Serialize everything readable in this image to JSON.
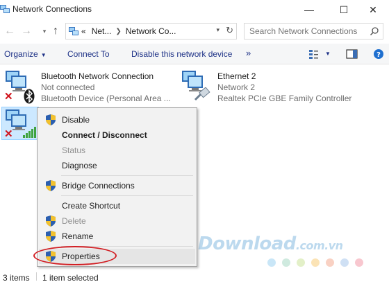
{
  "window": {
    "title": "Network Connections",
    "minimize": "—",
    "maximize": "☐",
    "close": "✕"
  },
  "nav": {
    "back": "←",
    "forward": "→",
    "up": "↑"
  },
  "address": {
    "overflow": "«",
    "crumb1": "Net...",
    "crumb2": "Network Co..."
  },
  "search": {
    "placeholder": "Search Network Connections"
  },
  "toolbar": {
    "organize": "Organize",
    "connect_to": "Connect To",
    "disable_device": "Disable this network device",
    "more": "»"
  },
  "items": [
    {
      "name": "Bluetooth Network Connection",
      "status": "Not connected",
      "device": "Bluetooth Device (Personal Area ..."
    },
    {
      "name": "Ethernet 2",
      "status": "Network  2",
      "device": "Realtek PCIe GBE Family Controller"
    }
  ],
  "context_menu": {
    "disable": "Disable",
    "connect_disconnect": "Connect / Disconnect",
    "status": "Status",
    "diagnose": "Diagnose",
    "bridge": "Bridge Connections",
    "create_shortcut": "Create Shortcut",
    "delete": "Delete",
    "rename": "Rename",
    "properties": "Properties"
  },
  "statusbar": {
    "count": "3 items",
    "selected": "1 item selected"
  },
  "watermark": {
    "brand": "Download",
    "domain": ".com.vn"
  },
  "colors": {
    "accent": "#1e3287",
    "selection": "#cce8ff",
    "annotation": "#d21f24",
    "watermark_dots": [
      "#c9e6f7",
      "#cfeadf",
      "#e3f0c8",
      "#fbe3b5",
      "#f9d1c3",
      "#cfe0f4",
      "#f8c7cf"
    ]
  }
}
